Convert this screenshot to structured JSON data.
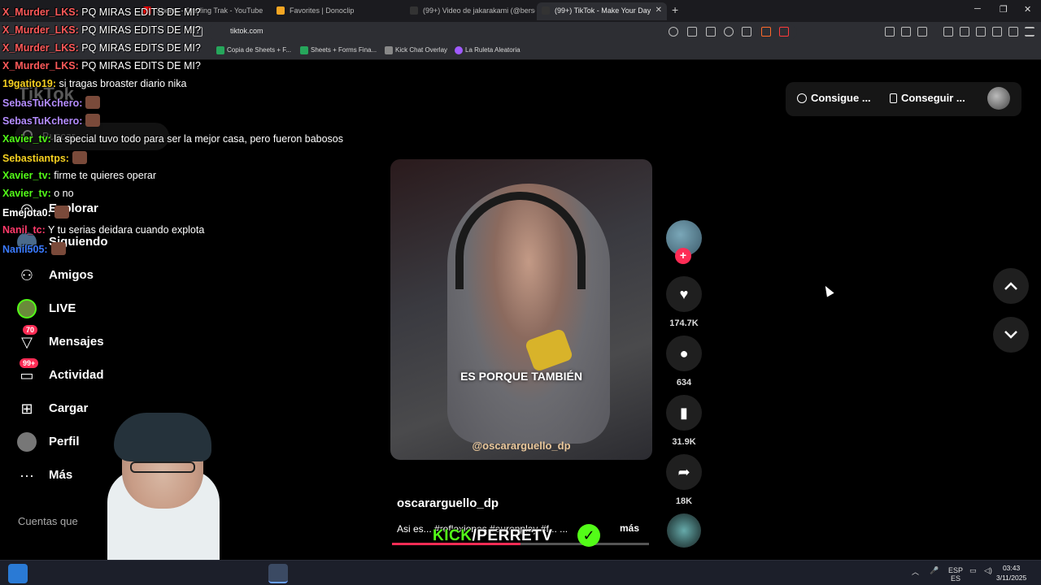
{
  "browser": {
    "tabs": [
      {
        "title": "Sheets - Grading Trak - YouTube",
        "favicon_color": "#ff0000"
      },
      {
        "title": "Favorites | Donoclip",
        "favicon_color": "#f5a623"
      },
      {
        "title": "(99+) Video de jakarakami (@berserk...",
        "favicon_color": "#111111"
      },
      {
        "title": "(99+) TikTok - Make Your Day",
        "favicon_color": "#111111"
      }
    ],
    "url": "tiktok.com",
    "bookmarks": [
      {
        "label": "Copia de Sheets + F..."
      },
      {
        "label": "Sheets + Forms Fina..."
      },
      {
        "label": "Kick Chat Overlay"
      },
      {
        "label": "La Ruleta Aleatoria"
      }
    ]
  },
  "tiktok": {
    "logo": "TikTok",
    "search_placeholder": "Buscar",
    "nav": [
      {
        "label": "Explorar",
        "icon": "compass-icon"
      },
      {
        "label": "Siguiendo",
        "icon": "following-icon"
      },
      {
        "label": "Amigos",
        "icon": "friends-icon"
      },
      {
        "label": "LIVE",
        "icon": "live-icon"
      },
      {
        "label": "Mensajes",
        "icon": "messages-icon",
        "badge": "70"
      },
      {
        "label": "Actividad",
        "icon": "activity-icon",
        "badge": "99+"
      },
      {
        "label": "Cargar",
        "icon": "upload-icon"
      },
      {
        "label": "Perfil",
        "icon": "profile-icon"
      },
      {
        "label": "Más",
        "icon": "more-icon"
      }
    ],
    "following_accounts_label": "Cuentas que",
    "top_buttons": {
      "get_coins": "Consigue ...",
      "get_app": "Conseguir ..."
    },
    "video": {
      "caption": "ES PORQUE TAMBIÉN",
      "watermark": "@oscararguello_dp",
      "creator": "oscararguello_dp",
      "description": "Asi es... #reflexiones #auronplay #f... ...",
      "more_label": "más",
      "progress": 0.5
    },
    "actions": {
      "likes": "174.7K",
      "comments": "634",
      "saves": "31.9K",
      "shares": "18K"
    }
  },
  "chat_overlay": [
    {
      "user": "X_Murder_LKS",
      "color": "#ff5a5a",
      "message": "PQ MIRAS EDITS DE MI?"
    },
    {
      "user": "X_Murder_LKS",
      "color": "#ff5a5a",
      "message": "PQ MIRAS EDITS DE MI?"
    },
    {
      "user": "X_Murder_LKS",
      "color": "#ff5a5a",
      "message": "PQ MIRAS EDITS DE MI?"
    },
    {
      "user": "X_Murder_LKS",
      "color": "#ff5a5a",
      "message": "PQ MIRAS EDITS DE MI?"
    },
    {
      "user": "19gatito19",
      "color": "#f5d020",
      "message": "si tragas broaster diario nika"
    },
    {
      "user": "SebasTuKchero",
      "color": "#b48cff",
      "message": ""
    },
    {
      "user": "SebasTuKchero",
      "color": "#b48cff",
      "message": ""
    },
    {
      "user": "Xavier_tv",
      "color": "#53fc18",
      "message": "la special tuvo todo para ser la mejor casa, pero fueron babosos"
    },
    {
      "user": "Sebastiantps",
      "color": "#f5d020",
      "message": ""
    },
    {
      "user": "Xavier_tv",
      "color": "#53fc18",
      "message": "firme te quieres operar"
    },
    {
      "user": "Xavier_tv",
      "color": "#53fc18",
      "message": "o no"
    },
    {
      "user": "Emejota0",
      "color": "#ffffff",
      "message": ""
    },
    {
      "user": "Nanil_tc",
      "color": "#ff3a6a",
      "message": "Y tu serias deidara cuando explota"
    },
    {
      "user": "Nanil505",
      "color": "#3a7aff",
      "message": ""
    }
  ],
  "stream_brand": {
    "kick": "KICK",
    "slash": "/",
    "name": "PERRETV"
  },
  "taskbar": {
    "lang_top": "ESP",
    "lang_bottom": "ES",
    "time": "03:43",
    "date": "3/11/2025"
  }
}
